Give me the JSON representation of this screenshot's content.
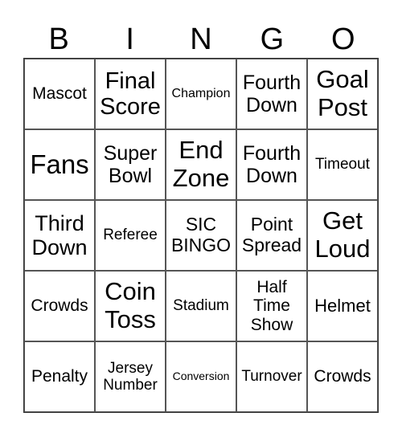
{
  "header": [
    "B",
    "I",
    "N",
    "G",
    "O"
  ],
  "cells": [
    [
      "Mascot",
      "Final\nScore",
      "Champion",
      "Fourth\nDown",
      "Goal\nPost"
    ],
    [
      "Fans",
      "Super\nBowl",
      "End\nZone",
      "Fourth\nDown",
      "Timeout"
    ],
    [
      "Third\nDown",
      "Referee",
      "SIC\nBINGO",
      "Point\nSpread",
      "Get\nLoud"
    ],
    [
      "Crowds",
      "Coin\nToss",
      "Stadium",
      "Half\nTime\nShow",
      "Helmet"
    ],
    [
      "Penalty",
      "Jersey\nNumber",
      "Conversion",
      "Turnover",
      "Crowds"
    ]
  ]
}
